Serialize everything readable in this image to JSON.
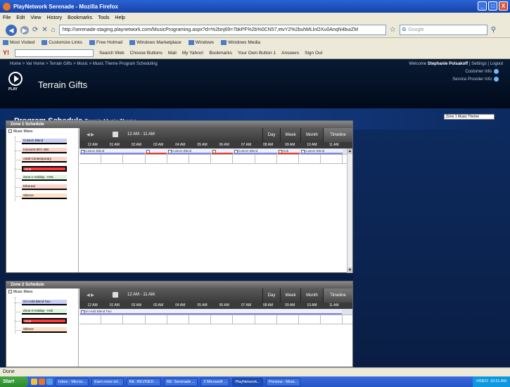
{
  "window": {
    "title": "PlayNetwork Serenade - Mozilla Firefox",
    "min": "_",
    "max": "□",
    "close": "X"
  },
  "menu": [
    "File",
    "Edit",
    "View",
    "History",
    "Bookmarks",
    "Tools",
    "Help"
  ],
  "nav": {
    "url": "http://serenade-staging.playnetwork.com/MusicPrograming.aspx?d=%2bnj69=7bkPF%2b%0CN57,etvY2%2buhMLlnOXu0AnqN4buiZM",
    "search_placeholder": "Google"
  },
  "bookmarks": [
    "Most Visited",
    "Customize Links",
    "Free Hotmail",
    "Windows Marketplace",
    "Windows",
    "Windows Media"
  ],
  "yahoo": {
    "logo": "Y!",
    "items": [
      "Search Web",
      "Choose Buttons",
      "Mail",
      "My Yahoo!",
      "Bookmarks",
      "Your Own Button 1",
      "Answers",
      "Sign Out"
    ]
  },
  "page": {
    "breadcrumb": "Home > Var Home > Terrain Gifts > Music > Music Theme Program Scheduling",
    "welcome_prefix": "Welcome",
    "welcome_user": "Stephanie Polsakoff",
    "welcome_links": "| Settings | Logout",
    "customer_info": "Customer Info",
    "service_provider_info": "Service Provider Info",
    "logo_text": "PLAY",
    "site_name": "Terrain Gifts",
    "title": "Program Schedule",
    "subtitle": "Terrain Music Theme",
    "zone_select": "Zone 1 Music Theme"
  },
  "zone1": {
    "header": "Zone 1 Schedule",
    "root": "Music Mixes",
    "items": [
      {
        "label": "Custom Blend",
        "color": "#9aa6f2"
      },
      {
        "label": "Innocent 80's: 90s",
        "color": "#ff6a4a"
      },
      {
        "label": "Adult Contemporary",
        "color": "#ff6a4a"
      },
      {
        "label": "Club",
        "color": "#ff2a2a"
      },
      {
        "label": "Zone 1 Holiday - HOL",
        "color": "#22cc22"
      },
      {
        "label": "Ethereal",
        "color": "#e83a2a"
      },
      {
        "label": "Silence",
        "color": "#ff8a1a"
      }
    ],
    "range": "12 AM - 11 AM",
    "views": [
      "Day",
      "Week",
      "Month",
      "Timeline"
    ],
    "hours": [
      "12 AM",
      "01 AM",
      "02 AM",
      "03 AM",
      "04 AM",
      "05 AM",
      "06 AM",
      "07 AM",
      "08 AM",
      "09 AM",
      "10 AM",
      "11 AM"
    ],
    "events": [
      {
        "label": "Custom Blend",
        "color": "#7a86e8"
      },
      {
        "label": "",
        "color": "#e83a2a"
      },
      {
        "label": "Custom Blend",
        "color": "#7a86e8"
      },
      {
        "label": "",
        "color": "#e83a2a"
      },
      {
        "label": "Custom Blend",
        "color": "#7a86e8"
      },
      {
        "label": "Club",
        "color": "#e83a2a"
      },
      {
        "label": "Custom Blend",
        "color": "#7a86e8"
      }
    ]
  },
  "zone2": {
    "header": "Zone 2 Schedule",
    "root": "Music Mixes",
    "items": [
      {
        "label": "On Hold Blend Two",
        "color": "#9aa6f2"
      },
      {
        "label": "Zone 2 Holiday - Holi",
        "color": "#22cc22"
      },
      {
        "label": "Club",
        "color": "#ff2a2a"
      },
      {
        "label": "Silence",
        "color": "#ff8a1a"
      }
    ],
    "range": "12 AM - 11 AM",
    "views": [
      "Day",
      "Week",
      "Month",
      "Timeline"
    ],
    "hours": [
      "12 AM",
      "01 AM",
      "02 AM",
      "03 AM",
      "04 AM",
      "05 AM",
      "06 AM",
      "07 AM",
      "08 AM",
      "09 AM",
      "10 AM",
      "11 AM"
    ],
    "events": [
      {
        "label": "On Hold Blend Two",
        "color": "#7a86e8"
      }
    ]
  },
  "status": "Done",
  "taskbar": {
    "start": "Start",
    "tasks": [
      "Inbox - Micros...",
      "Earn more inf...",
      "RE: REVISED ...",
      "RE: Serenade ...",
      "2 Microsoft ...",
      "PlayNetwork...",
      "Preview - Most...",
      "VIDEO"
    ],
    "time": "10:31 AM"
  }
}
